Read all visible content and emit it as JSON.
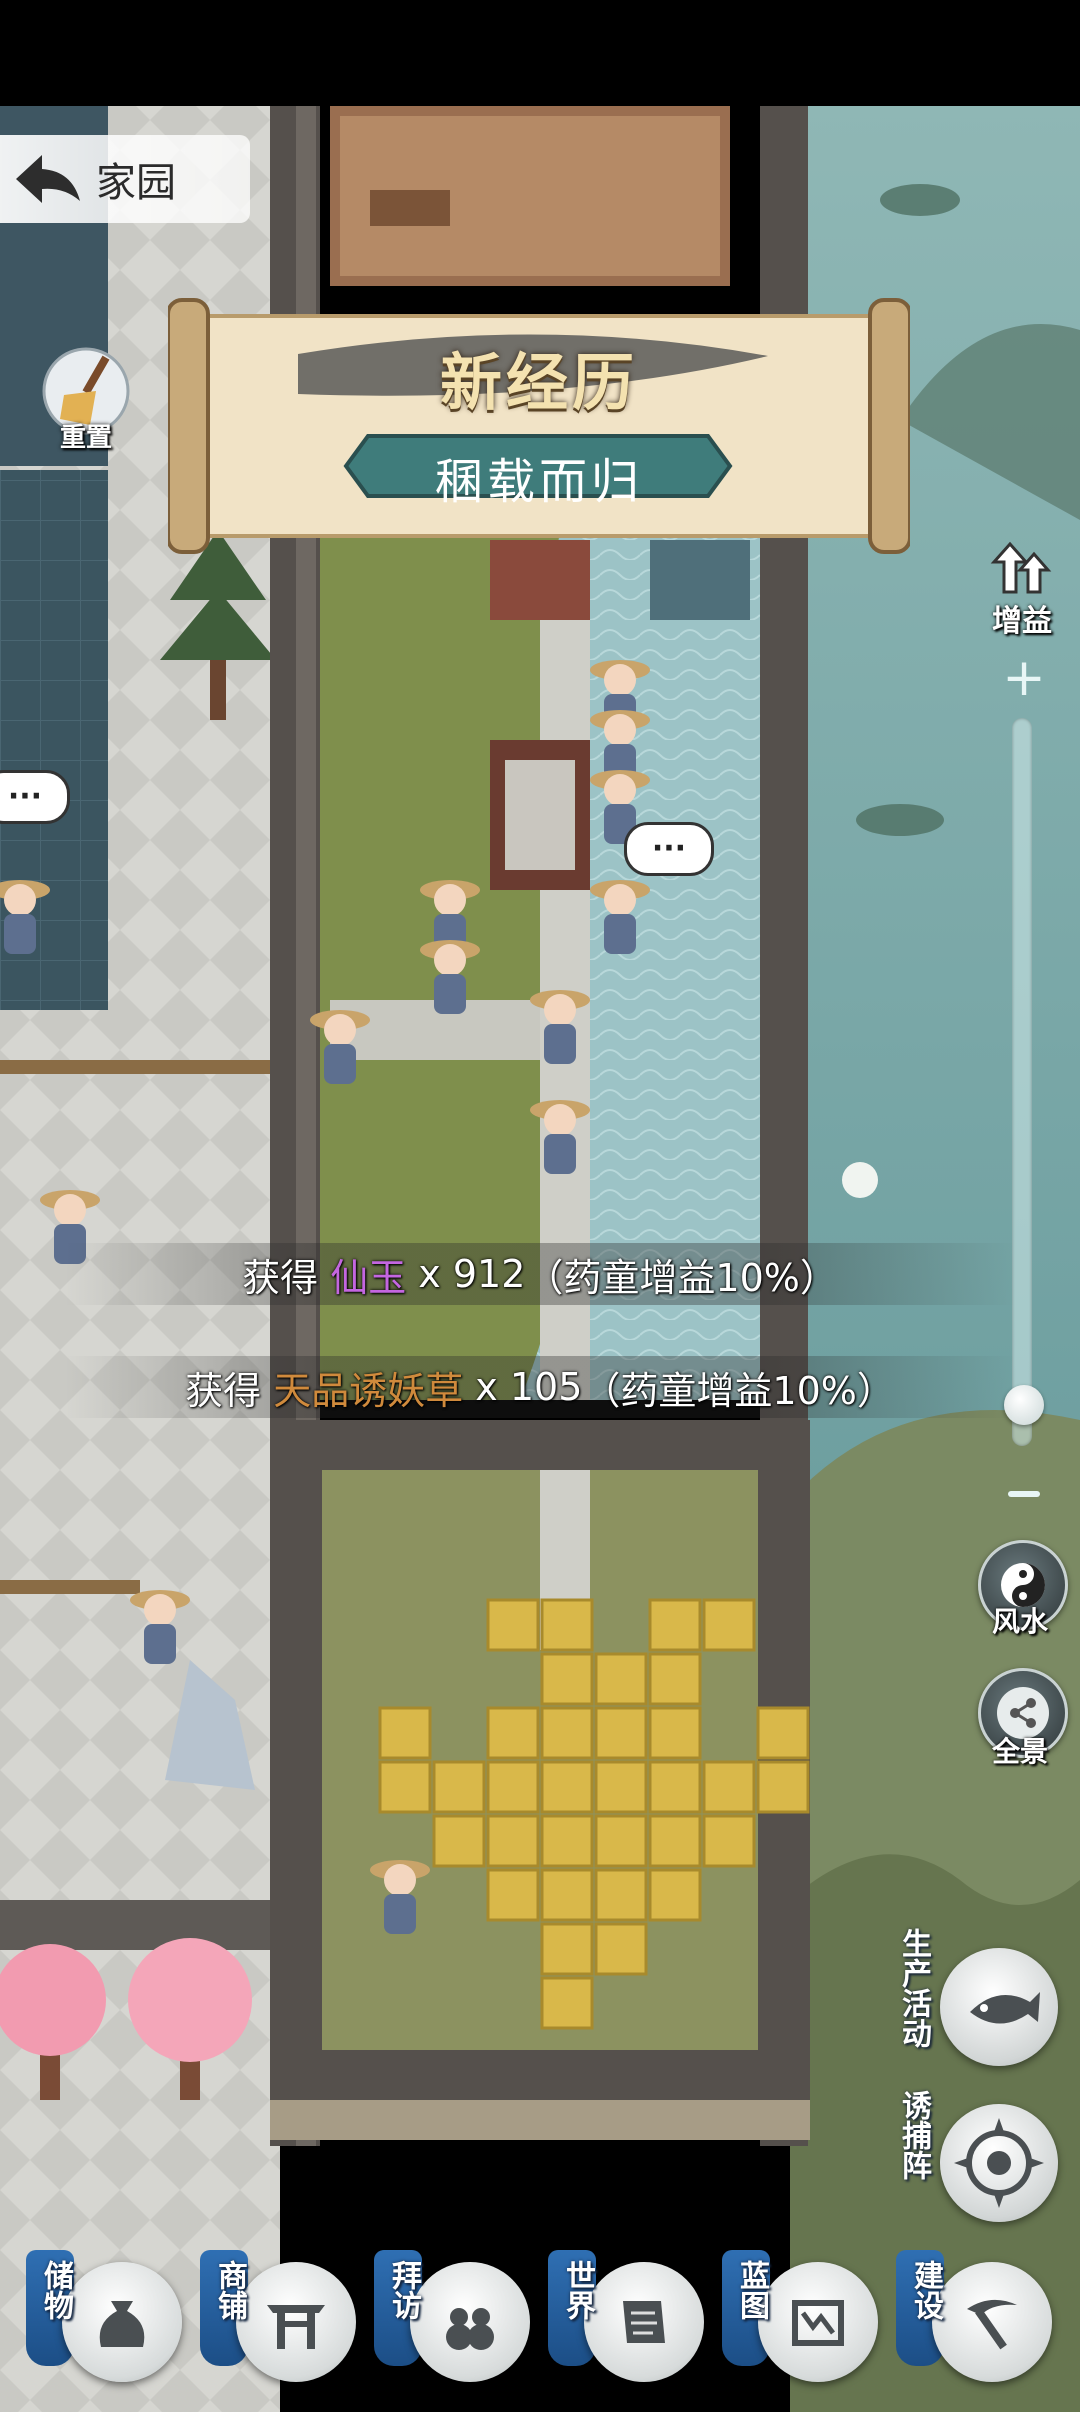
{
  "nav": {
    "title": "家园",
    "clean_label": "重置"
  },
  "banner": {
    "title": "新经历",
    "subtitle": "稛载而归"
  },
  "bubbles": {
    "ellipsis": "···"
  },
  "side_controls": {
    "boost_label": "增益",
    "zoom_level": 0.03,
    "fengshui_label": "风水",
    "panorama_label": "全景"
  },
  "rewards": [
    {
      "prefix": "获得 ",
      "item": "仙玉",
      "item_color": "#c466e0",
      "qty": " x 912",
      "note": "（药童增益10%）"
    },
    {
      "prefix": "获得 ",
      "item": "天品诱妖草",
      "item_color": "#d08a3c",
      "qty": " x 105",
      "note": "（药童增益10%）"
    }
  ],
  "activities": {
    "production_label": "生产活动",
    "trap_label": "诱捕阵"
  },
  "bottom_bar": [
    {
      "label": "储物",
      "icon": "bag-icon"
    },
    {
      "label": "商铺",
      "icon": "shop-gate-icon"
    },
    {
      "label": "拜访",
      "icon": "visit-gourd-icon"
    },
    {
      "label": "世界",
      "icon": "scroll-map-icon"
    },
    {
      "label": "蓝图",
      "icon": "blueprint-icon"
    },
    {
      "label": "建设",
      "icon": "pickaxe-icon"
    }
  ],
  "colors": {
    "water": "#6e9fa0",
    "grass": "#7f8f4c",
    "banner_ribbon": "#3f7c7b",
    "bottom_ribbon": "#2f6fb3"
  }
}
